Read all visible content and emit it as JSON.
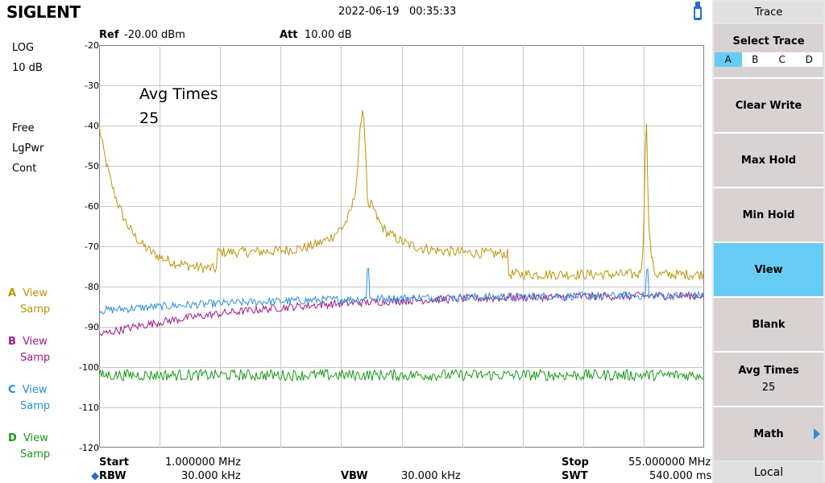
{
  "header": {
    "brand": "SIGLENT",
    "datetime": "2022-06-19   00:35:33",
    "ref_label": "Ref",
    "ref_value": "-20.00 dBm",
    "att_label": "Att",
    "att_value": "10.00 dB"
  },
  "left_panel": {
    "scale_type": "LOG",
    "scale_div": "10 dB",
    "trigger": "Free",
    "detector": "LgPwr",
    "sweep_mode": "Cont",
    "traces": [
      {
        "letter": "A",
        "mode": "View",
        "det": "Samp",
        "color": "#b8960a"
      },
      {
        "letter": "B",
        "mode": "View",
        "det": "Samp",
        "color": "#a01a88"
      },
      {
        "letter": "C",
        "mode": "View",
        "det": "Samp",
        "color": "#2a8fd8"
      },
      {
        "letter": "D",
        "mode": "View",
        "det": "Samp",
        "color": "#1a9a1a"
      }
    ]
  },
  "plot": {
    "annotation_line1": "Avg Times",
    "annotation_line2": "25",
    "y_ticks": [
      "-20",
      "-30",
      "-40",
      "-50",
      "-60",
      "-70",
      "-80",
      "-90",
      "-100",
      "-110",
      "-120"
    ]
  },
  "footer": {
    "start_label": "Start",
    "start_value": "1.000000 MHz",
    "stop_label": "Stop",
    "stop_value": "55.000000 MHz",
    "rbw_label": "RBW",
    "rbw_value": "30.000 kHz",
    "vbw_label": "VBW",
    "vbw_value": "30.000 kHz",
    "swt_label": "SWT",
    "swt_value": "540.000 ms"
  },
  "menu": {
    "title": "Trace",
    "select_trace_label": "Select Trace",
    "select_options": [
      "A",
      "B",
      "C",
      "D"
    ],
    "selected": "A",
    "clear_write": "Clear Write",
    "max_hold": "Max Hold",
    "min_hold": "Min Hold",
    "view": "View",
    "blank": "Blank",
    "avg_times_label": "Avg Times",
    "avg_times_value": "25",
    "math": "Math",
    "local": "Local"
  },
  "colors": {
    "trace_a": "#b8960a",
    "trace_b": "#a01a88",
    "trace_c": "#2a8fd8",
    "trace_d": "#1a9a1a",
    "active_key": "#66ccf5"
  }
}
